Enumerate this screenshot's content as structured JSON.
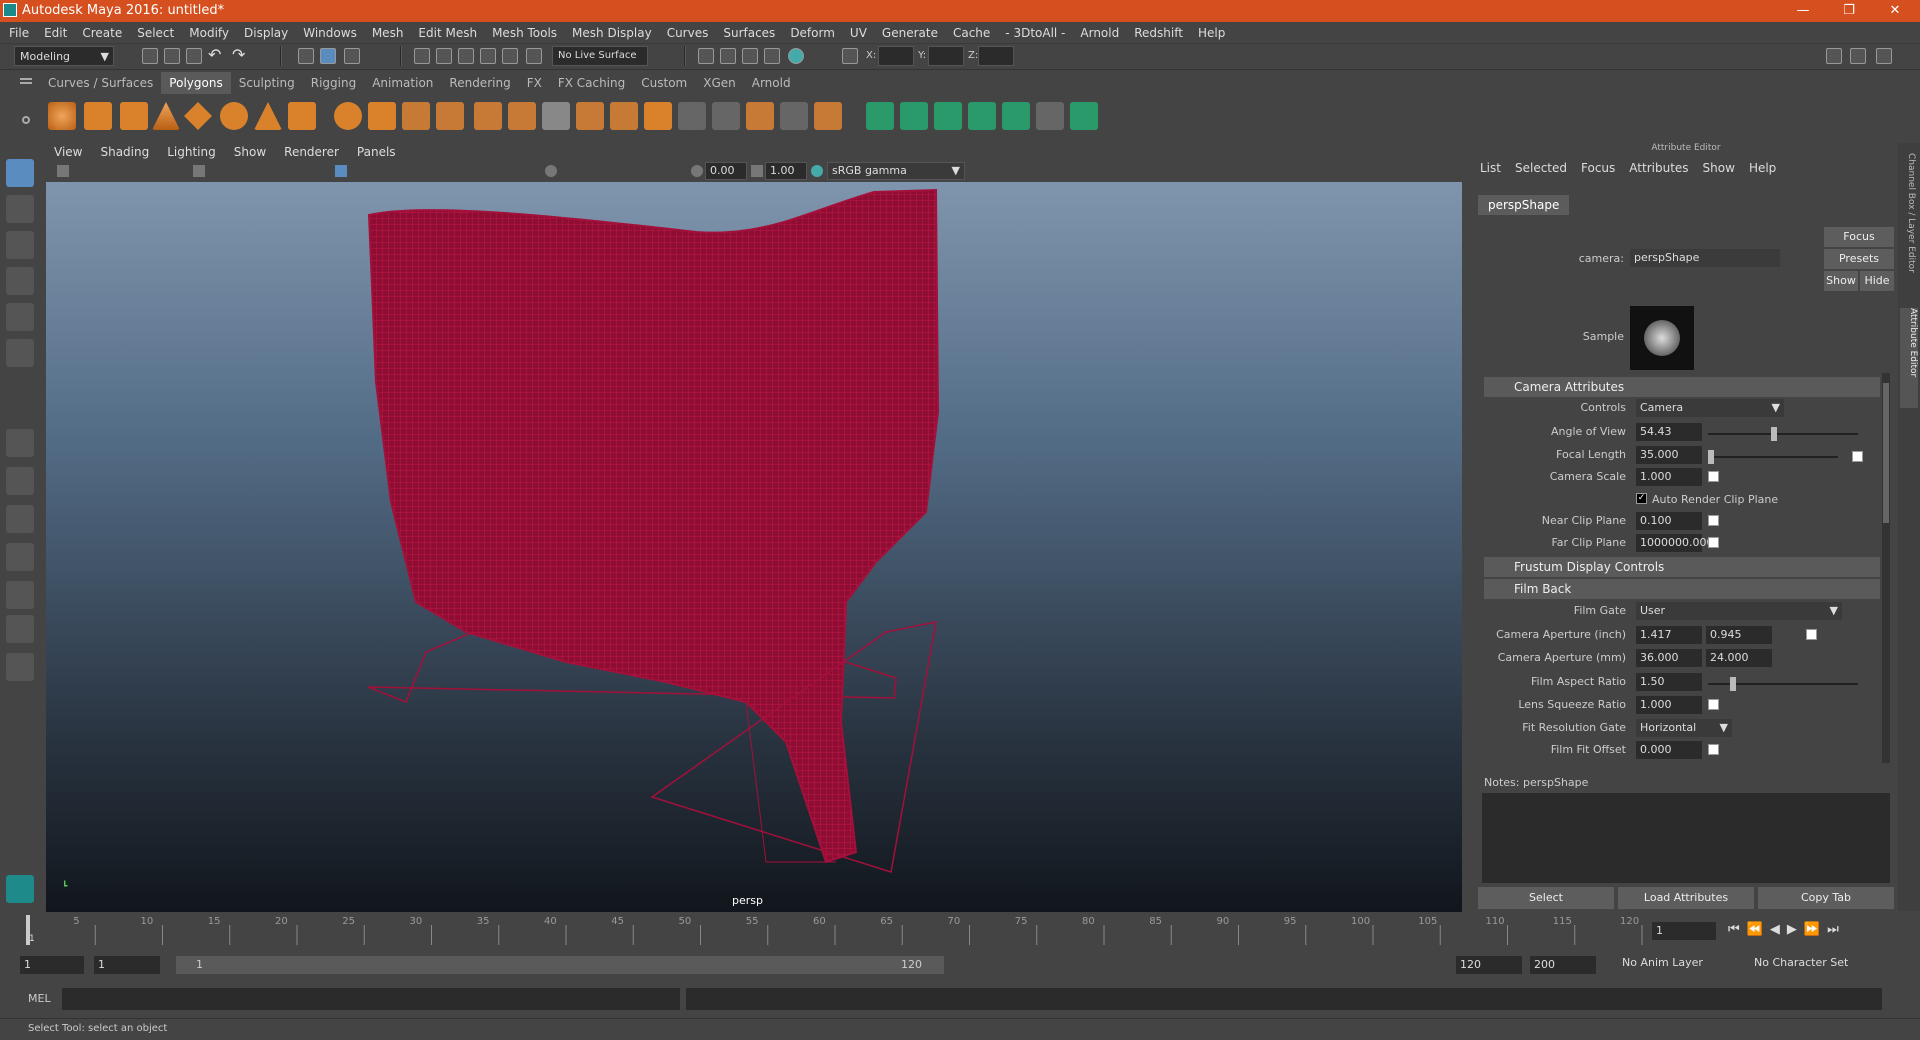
{
  "window": {
    "title": "Autodesk Maya 2016: untitled*",
    "minimize": "—",
    "maximize": "❐",
    "close": "✕"
  },
  "menubar": [
    "File",
    "Edit",
    "Create",
    "Select",
    "Modify",
    "Display",
    "Windows",
    "Mesh",
    "Edit Mesh",
    "Mesh Tools",
    "Mesh Display",
    "Curves",
    "Surfaces",
    "Deform",
    "UV",
    "Generate",
    "Cache",
    "- 3DtoAll -",
    "Arnold",
    "Redshift",
    "Help"
  ],
  "statusline": {
    "mode": "Modeling",
    "live_surface": "No Live Surface",
    "x_label": "X:",
    "y_label": "Y:",
    "z_label": "Z:"
  },
  "shelf_tabs": [
    "Curves / Surfaces",
    "Polygons",
    "Sculpting",
    "Rigging",
    "Animation",
    "Rendering",
    "FX",
    "FX Caching",
    "Custom",
    "XGen",
    "Arnold"
  ],
  "shelf_active": "Polygons",
  "panel_menu": [
    "View",
    "Shading",
    "Lighting",
    "Show",
    "Renderer",
    "Panels"
  ],
  "view_toolbar": {
    "exposure": "0.00",
    "gamma": "1.00",
    "colorspace": "sRGB gamma"
  },
  "viewport": {
    "camera_label": "persp",
    "mesh_color": "#a3103a"
  },
  "attribute_editor": {
    "header": "Attribute Editor",
    "menu": [
      "List",
      "Selected",
      "Focus",
      "Attributes",
      "Show",
      "Help"
    ],
    "tab": "perspShape",
    "camera_label": "camera:",
    "camera_value": "perspShape",
    "buttons": {
      "focus": "Focus",
      "presets": "Presets",
      "show": "Show",
      "hide": "Hide"
    },
    "sample_label": "Sample",
    "sections": {
      "camera_attributes": "Camera Attributes",
      "frustum": "Frustum Display Controls",
      "film_back": "Film Back"
    },
    "camera_attrs": {
      "controls_label": "Controls",
      "controls_value": "Camera",
      "angle_label": "Angle of View",
      "angle_value": "54.43",
      "angle_level": 0.42,
      "focal_label": "Focal Length",
      "focal_value": "35.000",
      "focal_level": 0.0,
      "scale_label": "Camera Scale",
      "scale_value": "1.000",
      "auto_clip": "Auto Render Clip Plane",
      "near_label": "Near Clip Plane",
      "near_value": "0.100",
      "far_label": "Far Clip Plane",
      "far_value": "1000000.000"
    },
    "film_back": {
      "gate_label": "Film Gate",
      "gate_value": "User",
      "ap_inch_label": "Camera Aperture (inch)",
      "ap_inch_x": "1.417",
      "ap_inch_y": "0.945",
      "ap_mm_label": "Camera Aperture (mm)",
      "ap_mm_x": "36.000",
      "ap_mm_y": "24.000",
      "aspect_label": "Film Aspect Ratio",
      "aspect_value": "1.50",
      "squeeze_label": "Lens Squeeze Ratio",
      "squeeze_value": "1.000",
      "fitres_label": "Fit Resolution Gate",
      "fitres_value": "Horizontal",
      "fitoff_label": "Film Fit Offset",
      "fitoff_value": "0.000"
    },
    "notes_label": "Notes:  perspShape",
    "bottom_buttons": {
      "select": "Select",
      "load": "Load Attributes",
      "copy": "Copy Tab"
    }
  },
  "side_tabs": {
    "channel_box": "Channel Box / Layer Editor",
    "attr_editor": "Attribute Editor"
  },
  "timeline": {
    "ticks": [
      "5",
      "10",
      "15",
      "20",
      "25",
      "30",
      "35",
      "40",
      "45",
      "50",
      "55",
      "60",
      "65",
      "70",
      "75",
      "80",
      "85",
      "90",
      "95",
      "100",
      "105",
      "110",
      "115",
      "120"
    ],
    "start": "1",
    "current_frame": "1"
  },
  "range": {
    "start": "1",
    "playback_start": "1",
    "range_start": "1",
    "range_end": "120",
    "playback_end": "120",
    "end": "200",
    "anim_layer": "No Anim Layer",
    "char_set": "No Character Set"
  },
  "mel": {
    "label": "MEL"
  },
  "help_line": "Select Tool: select an object"
}
